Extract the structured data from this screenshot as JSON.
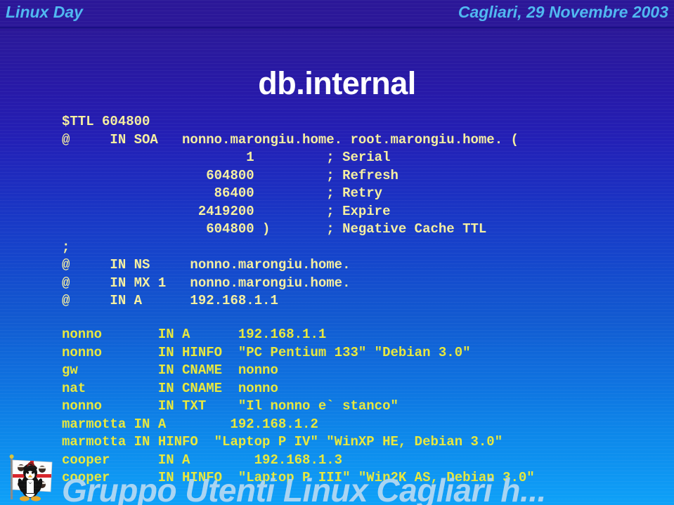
{
  "header": {
    "left": "Linux Day",
    "right": "Cagliari, 29 Novembre 2003",
    "accent_color": "#4fb8f0",
    "rule_color": "#1b0f85"
  },
  "title": "db.internal",
  "title_color": "#ffffff",
  "background": {
    "top_color": "#2b1798",
    "bottom_color": "#0ea2f8"
  },
  "zone_file": {
    "text_color_top": "#f5efa0",
    "text_color_bottom": "#e8e83c",
    "soa_block": [
      "$TTL 604800",
      "@     IN SOA   nonno.marongiu.home. root.marongiu.home. (",
      "                       1         ; Serial",
      "                  604800         ; Refresh",
      "                   86400         ; Retry",
      "                 2419200         ; Expire",
      "                  604800 )       ; Negative Cache TTL",
      ";",
      "@     IN NS     nonno.marongiu.home.",
      "@     IN MX 1   nonno.marongiu.home.",
      "@     IN A      192.168.1.1"
    ],
    "records_block": [
      "nonno       IN A      192.168.1.1",
      "nonno       IN HINFO  \"PC Pentium 133\" \"Debian 3.0\"",
      "gw          IN CNAME  nonno",
      "nat         IN CNAME  nonno",
      "nonno       IN TXT    \"Il nonno e` stanco\"",
      "marmotta IN A        192.168.1.2",
      "marmotta IN HINFO  \"Laptop P IV\" \"WinXP HE, Debian 3.0\"",
      "cooper      IN A        192.168.1.3",
      "cooper      IN HINFO  \"Laptop P III\" \"Win2K AS, Debian 3.0\""
    ]
  },
  "footer": {
    "text": "Gruppo Utenti Linux Cagliari h...",
    "color": "#a8d4f2",
    "mascot_label": "penguin-sardinian-flag"
  }
}
